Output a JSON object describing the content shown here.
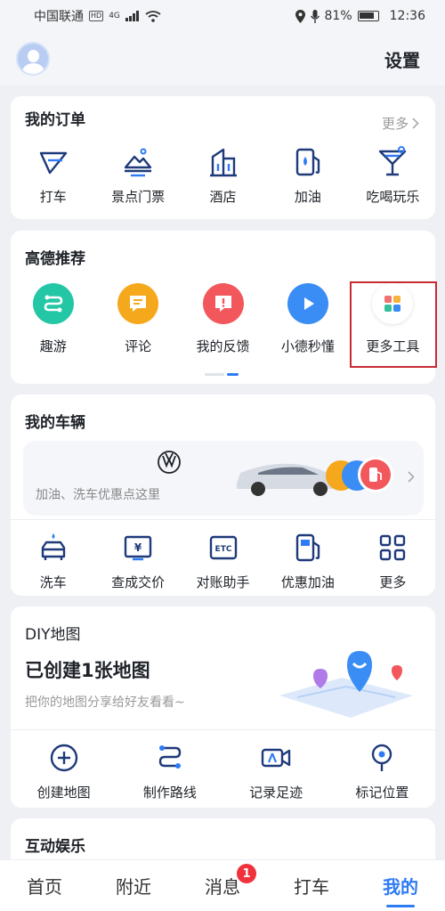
{
  "status_bar": {
    "carrier": "中国联通",
    "network": "4G",
    "battery": "81%",
    "time": "12:36"
  },
  "header": {
    "settings": "设置"
  },
  "orders": {
    "title": "我的订单",
    "more": "更多",
    "items": [
      {
        "label": "打车",
        "icon": "taxi-icon"
      },
      {
        "label": "景点门票",
        "icon": "scenic-ticket-icon"
      },
      {
        "label": "酒店",
        "icon": "hotel-icon"
      },
      {
        "label": "加油",
        "icon": "fuel-icon"
      },
      {
        "label": "吃喝玩乐",
        "icon": "cocktail-icon"
      }
    ]
  },
  "recommend": {
    "title": "高德推荐",
    "items": [
      {
        "label": "趣游",
        "icon": "route-icon",
        "color": "#23c7a5"
      },
      {
        "label": "评论",
        "icon": "comment-icon",
        "color": "#f5a81c"
      },
      {
        "label": "我的反馈",
        "icon": "feedback-icon",
        "color": "#f2575c"
      },
      {
        "label": "小德秒懂",
        "icon": "play-icon",
        "color": "#3a8df5"
      },
      {
        "label": "更多工具",
        "icon": "more-tools-icon",
        "color": "#ffffff"
      }
    ]
  },
  "vehicle": {
    "title": "我的车辆",
    "hint": "加油、洗车优惠点这里",
    "items": [
      {
        "label": "洗车",
        "icon": "car-wash-icon"
      },
      {
        "label": "查成交价",
        "icon": "price-icon"
      },
      {
        "label": "对账助手",
        "icon": "etc-icon"
      },
      {
        "label": "优惠加油",
        "icon": "discount-fuel-icon"
      },
      {
        "label": "更多",
        "icon": "grid-icon"
      }
    ]
  },
  "diy": {
    "title": "DIY地图",
    "headline": "已创建1张地图",
    "desc": "把你的地图分享给好友看看~",
    "items": [
      {
        "label": "创建地图",
        "icon": "plus-circle-icon"
      },
      {
        "label": "制作路线",
        "icon": "route-line-icon"
      },
      {
        "label": "记录足迹",
        "icon": "video-camera-icon"
      },
      {
        "label": "标记位置",
        "icon": "location-pin-icon"
      }
    ]
  },
  "entertainment": {
    "title": "互动娱乐"
  },
  "tabs": [
    {
      "label": "首页"
    },
    {
      "label": "附近"
    },
    {
      "label": "消息",
      "badge": "1"
    },
    {
      "label": "打车"
    },
    {
      "label": "我的",
      "active": true
    }
  ]
}
